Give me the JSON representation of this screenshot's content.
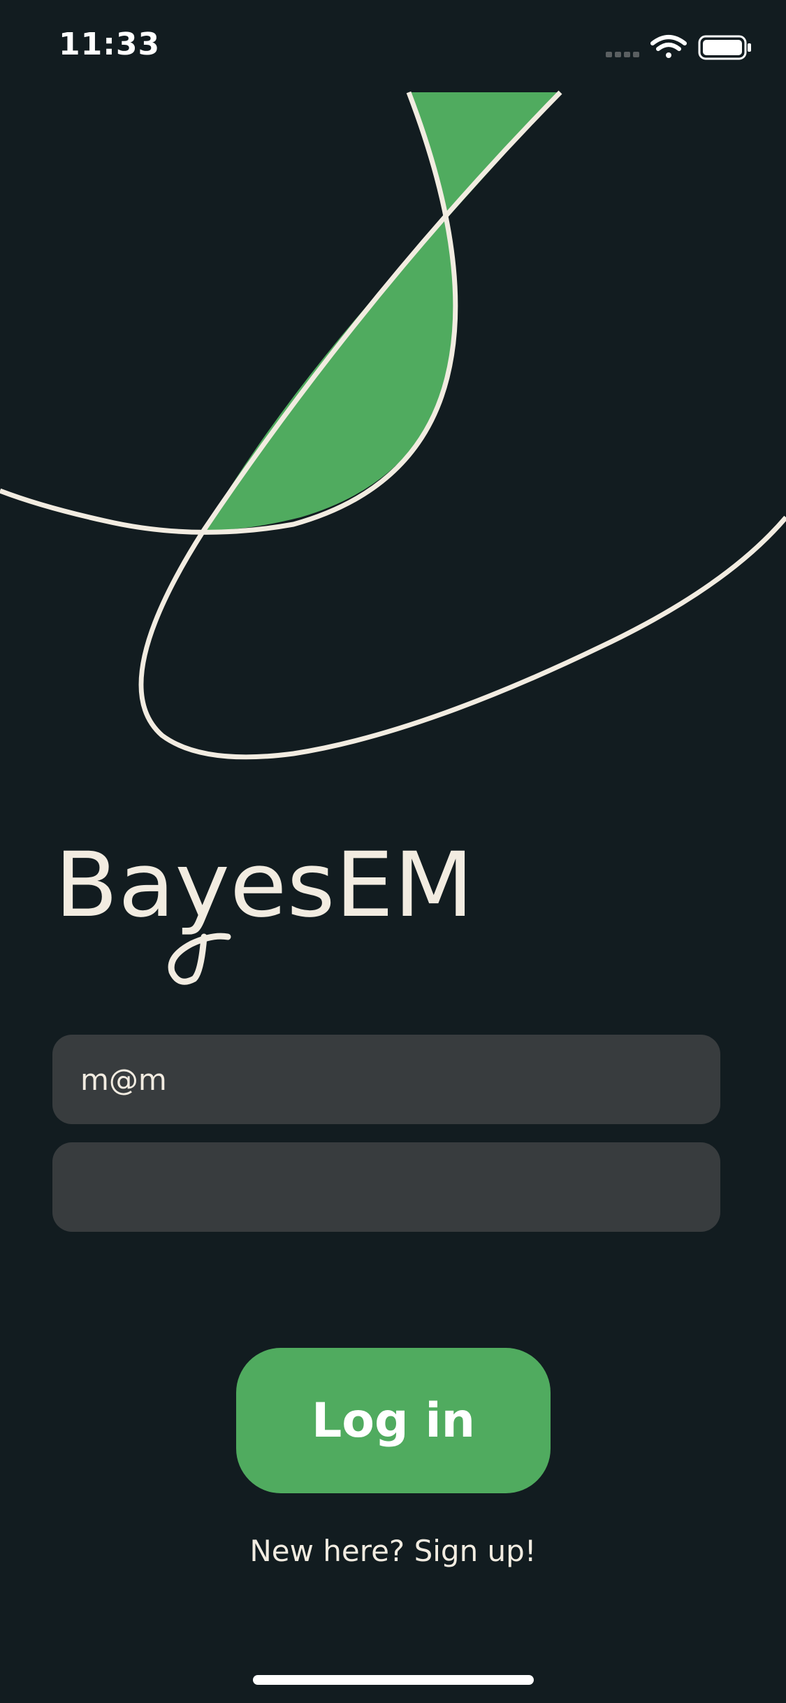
{
  "status_bar": {
    "time": "11:33",
    "icons": [
      "cellular-signal-icon",
      "wifi-icon",
      "battery-icon"
    ]
  },
  "brand": {
    "name": "BayesEM"
  },
  "login_form": {
    "email_value": "m@m",
    "password_value": "",
    "login_label": "Log in",
    "signup_label": "New here? Sign up!"
  },
  "colors": {
    "background": "#121c20",
    "accent_green": "#50ab5f",
    "cream": "#f2ece1",
    "input_bg": "#383c3e"
  }
}
